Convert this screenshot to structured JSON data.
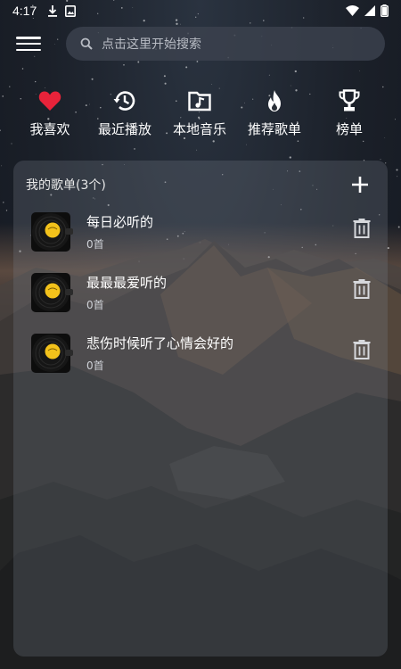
{
  "status_bar": {
    "time": "4:17",
    "left_icons": [
      "download-icon",
      "image-icon"
    ],
    "right_icons": [
      "wifi-icon",
      "signal-icon",
      "battery-icon"
    ]
  },
  "header": {
    "menu_icon": "menu-icon",
    "search": {
      "icon": "search-icon",
      "placeholder": "点击这里开始搜索"
    }
  },
  "quick_nav": [
    {
      "key": "favorites",
      "icon": "heart-icon",
      "label": "我喜欢",
      "color": "#e8233a"
    },
    {
      "key": "recent",
      "icon": "history-icon",
      "label": "最近播放",
      "color": "#ffffff"
    },
    {
      "key": "local",
      "icon": "music-folder-icon",
      "label": "本地音乐",
      "color": "#ffffff"
    },
    {
      "key": "recommend",
      "icon": "fire-icon",
      "label": "推荐歌单",
      "color": "#ffffff"
    },
    {
      "key": "charts",
      "icon": "trophy-icon",
      "label": "榜单",
      "color": "#ffffff"
    }
  ],
  "playlists": {
    "title": "我的歌单(3个)",
    "add_icon": "plus-icon",
    "items": [
      {
        "name": "每日必听的",
        "count": "0首",
        "icon": "vinyl-icon",
        "delete_icon": "trash-icon"
      },
      {
        "name": "最最最爱听的",
        "count": "0首",
        "icon": "vinyl-icon",
        "delete_icon": "trash-icon"
      },
      {
        "name": "悲伤时候听了心情会好的",
        "count": "0首",
        "icon": "vinyl-icon",
        "delete_icon": "trash-icon"
      }
    ]
  }
}
